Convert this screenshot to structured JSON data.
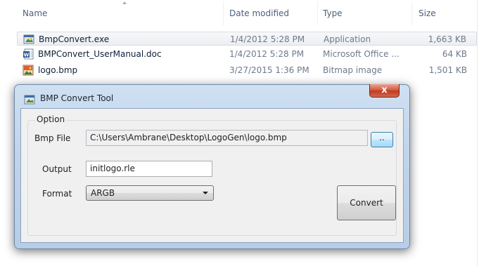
{
  "explorer": {
    "columns": {
      "name": "Name",
      "date": "Date modified",
      "type": "Type",
      "size": "Size"
    },
    "files": [
      {
        "name": "BmpConvert.exe",
        "date": "1/4/2012 5:28 PM",
        "type": "Application",
        "size": "1,663 KB",
        "icon": "application-icon"
      },
      {
        "name": "BMPConvert_UserManual.doc",
        "date": "1/4/2012 5:28 PM",
        "type": "Microsoft Office ...",
        "size": "64 KB",
        "icon": "word-document-icon"
      },
      {
        "name": "logo.bmp",
        "date": "3/27/2015 1:36 PM",
        "type": "Bitmap image",
        "size": "1,501 KB",
        "icon": "bitmap-image-icon"
      }
    ],
    "selected_row": 0
  },
  "dialog": {
    "title": "BMP Convert Tool",
    "close_label": "x",
    "group_label": "Option",
    "bmp_file_label": "Bmp File",
    "bmp_file_value": "C:\\Users\\Ambrane\\Desktop\\LogoGen\\logo.bmp",
    "browse_label": "..",
    "output_label": "Output",
    "output_value": "initlogo.rle",
    "format_label": "Format",
    "format_value": "ARGB",
    "convert_label": "Convert"
  },
  "colors": {
    "dialog_frame": "#c0d5ec",
    "close_button": "#c23a1e",
    "browse_button_border": "#3c7fb1"
  }
}
